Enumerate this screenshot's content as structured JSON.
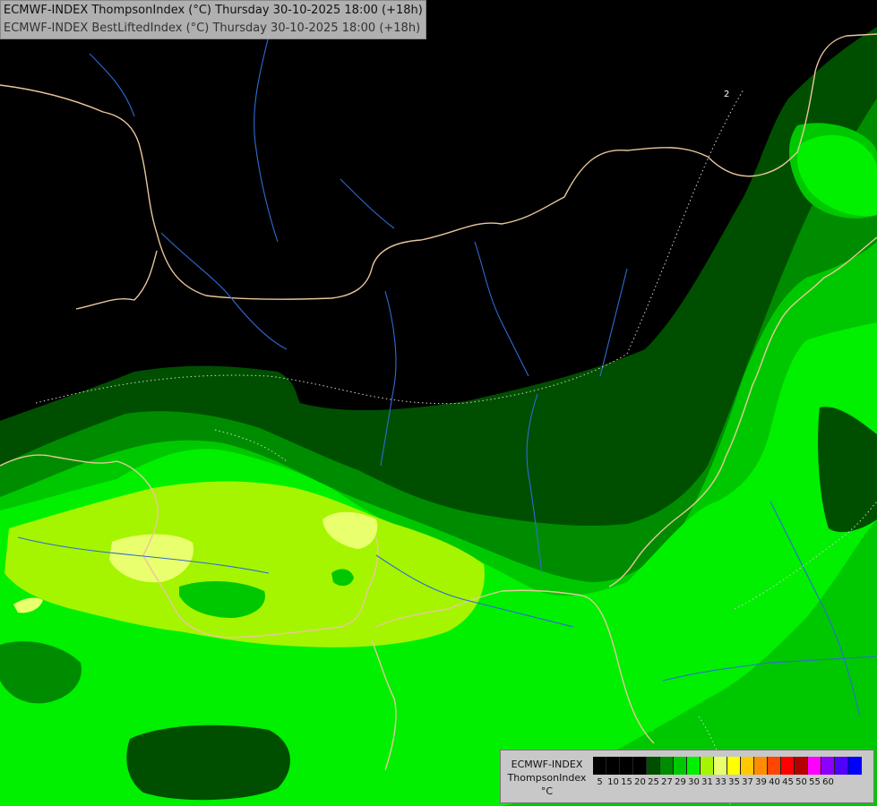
{
  "header": {
    "line1": "ECMWF-INDEX ThompsonIndex (°C) Thursday 30-10-2025 18:00 (+18h)",
    "line2": "ECMWF-INDEX BestLiftedIndex (°C) Thursday 30-10-2025 18:00 (+18h)"
  },
  "legend": {
    "label_line1": "ECMWF-INDEX",
    "label_line2": "ThompsonIndex",
    "label_line3": "°C",
    "ticks": [
      "5",
      "10",
      "15",
      "20",
      "25",
      "27",
      "29",
      "30",
      "31",
      "33",
      "35",
      "37",
      "39",
      "40",
      "45",
      "50",
      "55",
      "60"
    ],
    "colors": [
      "#000000",
      "#000000",
      "#000000",
      "#000000",
      "#004f00",
      "#008c00",
      "#00c800",
      "#00f000",
      "#a5f500",
      "#eaff6e",
      "#ffff00",
      "#ffc800",
      "#ff8c00",
      "#ff4600",
      "#ff0000",
      "#b40000",
      "#ff00ff",
      "#8c00ff",
      "#5000ff",
      "#0000ff"
    ]
  },
  "map": {
    "contour_label": "2",
    "colors": {
      "background": "#000000",
      "dark_green": "#004f00",
      "mid_green": "#008c00",
      "green": "#00c800",
      "bright_green": "#00f000",
      "yellow_green": "#a5f500",
      "pale_yellow": "#eaff6e",
      "border": "#e8c79a",
      "river": "#2f6bd4",
      "contour": "#d0d0d0"
    }
  }
}
